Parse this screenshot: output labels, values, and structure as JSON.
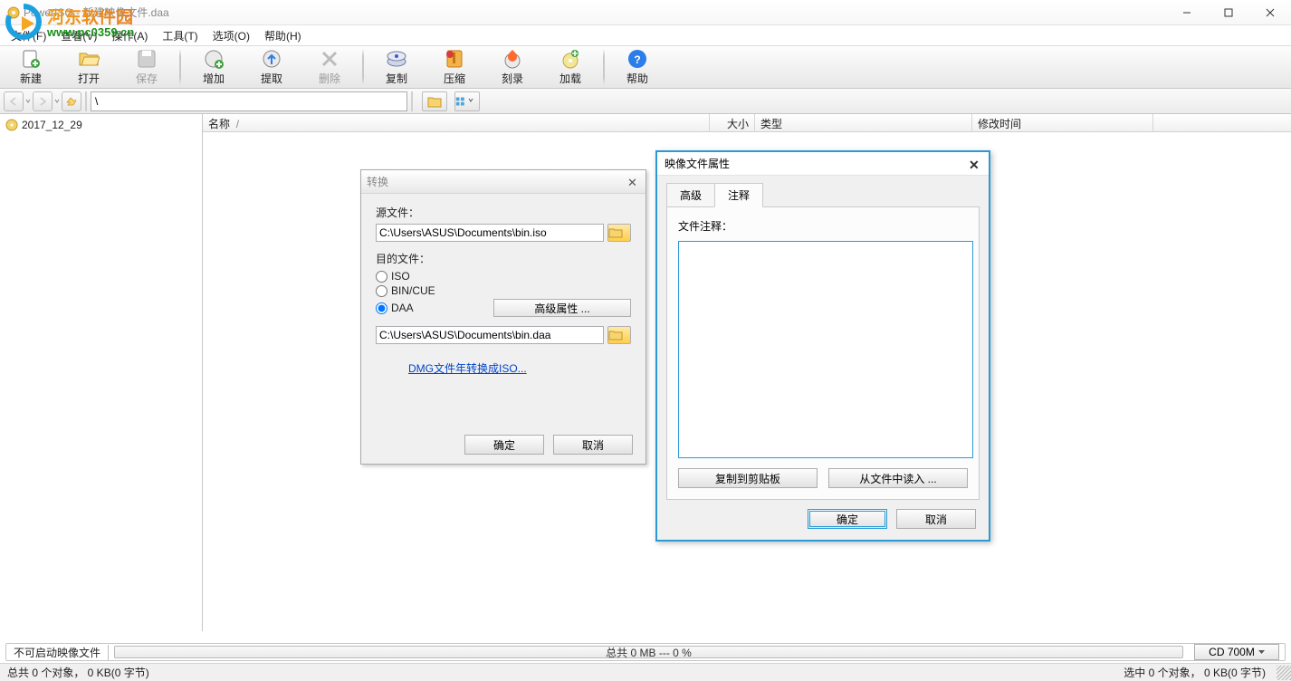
{
  "window": {
    "title": "PowerISO - 新建映像文件.daa"
  },
  "watermark": {
    "cn": "河东软件园",
    "url": "www.pc0359.cn"
  },
  "menu": {
    "file": "文件(F)",
    "view": "查看(V)",
    "action": "操作(A)",
    "tools": "工具(T)",
    "options": "选项(O)",
    "help": "帮助(H)"
  },
  "toolbar": {
    "new": "新建",
    "open": "打开",
    "save": "保存",
    "add": "增加",
    "extract": "提取",
    "delete": "删除",
    "copy": "复制",
    "compress": "压缩",
    "burn": "刻录",
    "mount": "加载",
    "help": "帮助"
  },
  "nav": {
    "path": "\\"
  },
  "tree": {
    "item1": "2017_12_29"
  },
  "columns": {
    "name": "名称",
    "size": "大小",
    "type": "类型",
    "date": "修改时间"
  },
  "list_sort": "/",
  "dlg_convert": {
    "title": "转换",
    "src_label": "源文件：",
    "src_value": "C:\\Users\\ASUS\\Documents\\bin.iso",
    "dst_label": "目的文件：",
    "opt_iso": "ISO",
    "opt_bincue": "BIN/CUE",
    "opt_daa": "DAA",
    "adv": "高级属性 ...",
    "dst_value": "C:\\Users\\ASUS\\Documents\\bin.daa",
    "link": "DMG文件年转换成ISO...",
    "ok": "确定",
    "cancel": "取消"
  },
  "dlg_props": {
    "title": "映像文件属性",
    "tab_adv": "高级",
    "tab_comment": "注释",
    "comment_label": "文件注释：",
    "copy_btn": "复制到剪贴板",
    "read_btn": "从文件中读入 ...",
    "ok": "确定",
    "cancel": "取消"
  },
  "progress": {
    "label": "不可启动映像文件",
    "text": "总共  0 MB  ---  0 %",
    "disc": "CD 700M"
  },
  "status": {
    "left": "总共 0 个对象，  0 KB(0 字节)",
    "right": "选中 0 个对象，  0 KB(0 字节)"
  }
}
